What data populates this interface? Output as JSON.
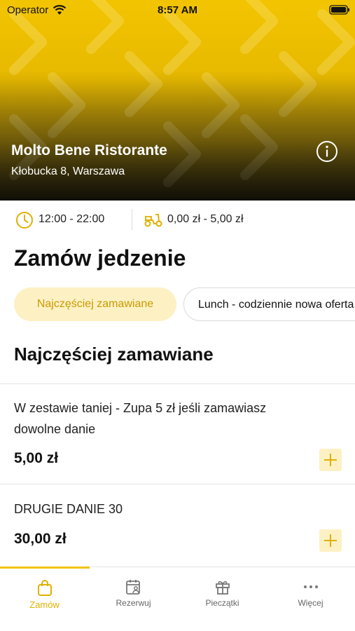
{
  "status_bar": {
    "carrier": "Operator",
    "time": "8:57 AM",
    "icons": [
      "wifi-icon",
      "battery-icon"
    ]
  },
  "restaurant": {
    "name": "Molto Bene Ristorante",
    "address": "Kłobucka 8, Warszawa",
    "info_icon": "info-icon"
  },
  "info_strip": {
    "hours_icon": "clock-icon",
    "hours": "12:00 - 22:00",
    "delivery_icon": "scooter-icon",
    "delivery_price": "0,00 zł - 5,00 zł"
  },
  "page": {
    "title": "Zamów jedzenie"
  },
  "categories": [
    {
      "label": "Najczęściej zamawiane",
      "active": true
    },
    {
      "label": "Lunch - codziennie nowa oferta",
      "active": false
    }
  ],
  "section": {
    "title": "Najczęściej zamawiane"
  },
  "items": [
    {
      "name": "W zestawie taniej - Zupa 5 zł jeśli zamawiasz dowolne danie",
      "price": "5,00 zł"
    },
    {
      "name": "DRUGIE DANIE 30",
      "price": "30,00 zł"
    }
  ],
  "tabbar": {
    "tabs": [
      {
        "label": "Zamów",
        "icon": "shopping-bag-icon",
        "active": true
      },
      {
        "label": "Rezerwuj",
        "icon": "calendar-person-icon",
        "active": false
      },
      {
        "label": "Pieczątki",
        "icon": "gift-icon",
        "active": false
      },
      {
        "label": "Więcej",
        "icon": "more-dots-icon",
        "active": false
      }
    ]
  },
  "colors": {
    "accent": "#f2c400",
    "accent_text": "#e0b000",
    "accent_light": "#fdf1c4"
  }
}
